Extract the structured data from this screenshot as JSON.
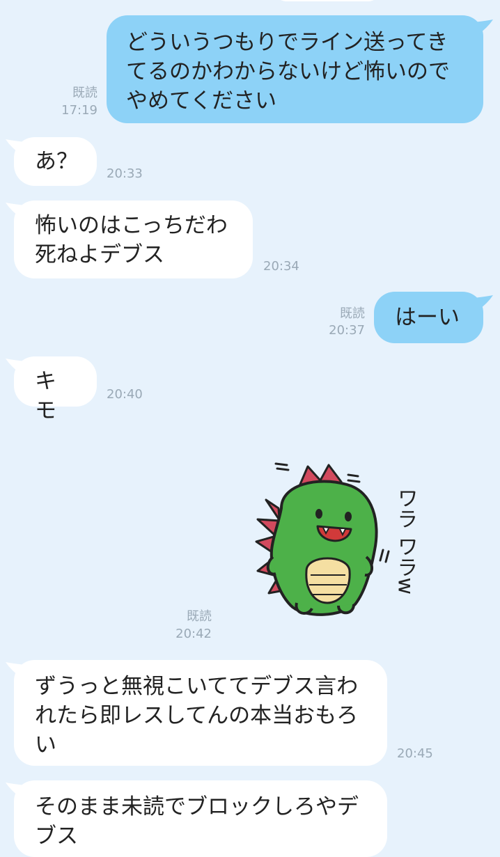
{
  "messages": [
    {
      "id": "m1",
      "side": "out",
      "text": "どういうつもりでライン送ってき\nてるのかわからないけど怖いので\nやめてください",
      "read_label": "既読",
      "time": "17:19"
    },
    {
      "id": "m2",
      "side": "in",
      "text": "あ？",
      "time": "20:33"
    },
    {
      "id": "m3",
      "side": "in",
      "text": "怖いのはこっちだわ\n死ねよデブス",
      "time": "20:34"
    },
    {
      "id": "m4",
      "side": "out",
      "text": "はーい",
      "read_label": "既読",
      "time": "20:37"
    },
    {
      "id": "m5",
      "side": "in",
      "text": "キモ",
      "time": "20:40"
    },
    {
      "id": "m6",
      "side": "out",
      "type": "sticker",
      "sticker_icon": "green-dinosaur-laughing-sticker",
      "read_label": "既読",
      "time": "20:42"
    },
    {
      "id": "m7",
      "side": "in",
      "text": "ずうっと無視こいててデブス言わ\nれたら即レスしてんの本当おもろ\nい",
      "time": "20:45"
    },
    {
      "id": "m8",
      "side": "in",
      "text": "そのまま未読でブロックしろやデ\nブス",
      "time": ""
    }
  ],
  "sticker_text": "ワラ ワラw",
  "colors": {
    "background": "#e7f2fc",
    "incoming_bubble": "#ffffff",
    "outgoing_bubble": "#8dd2f7",
    "meta_text": "#9aa9b6"
  }
}
